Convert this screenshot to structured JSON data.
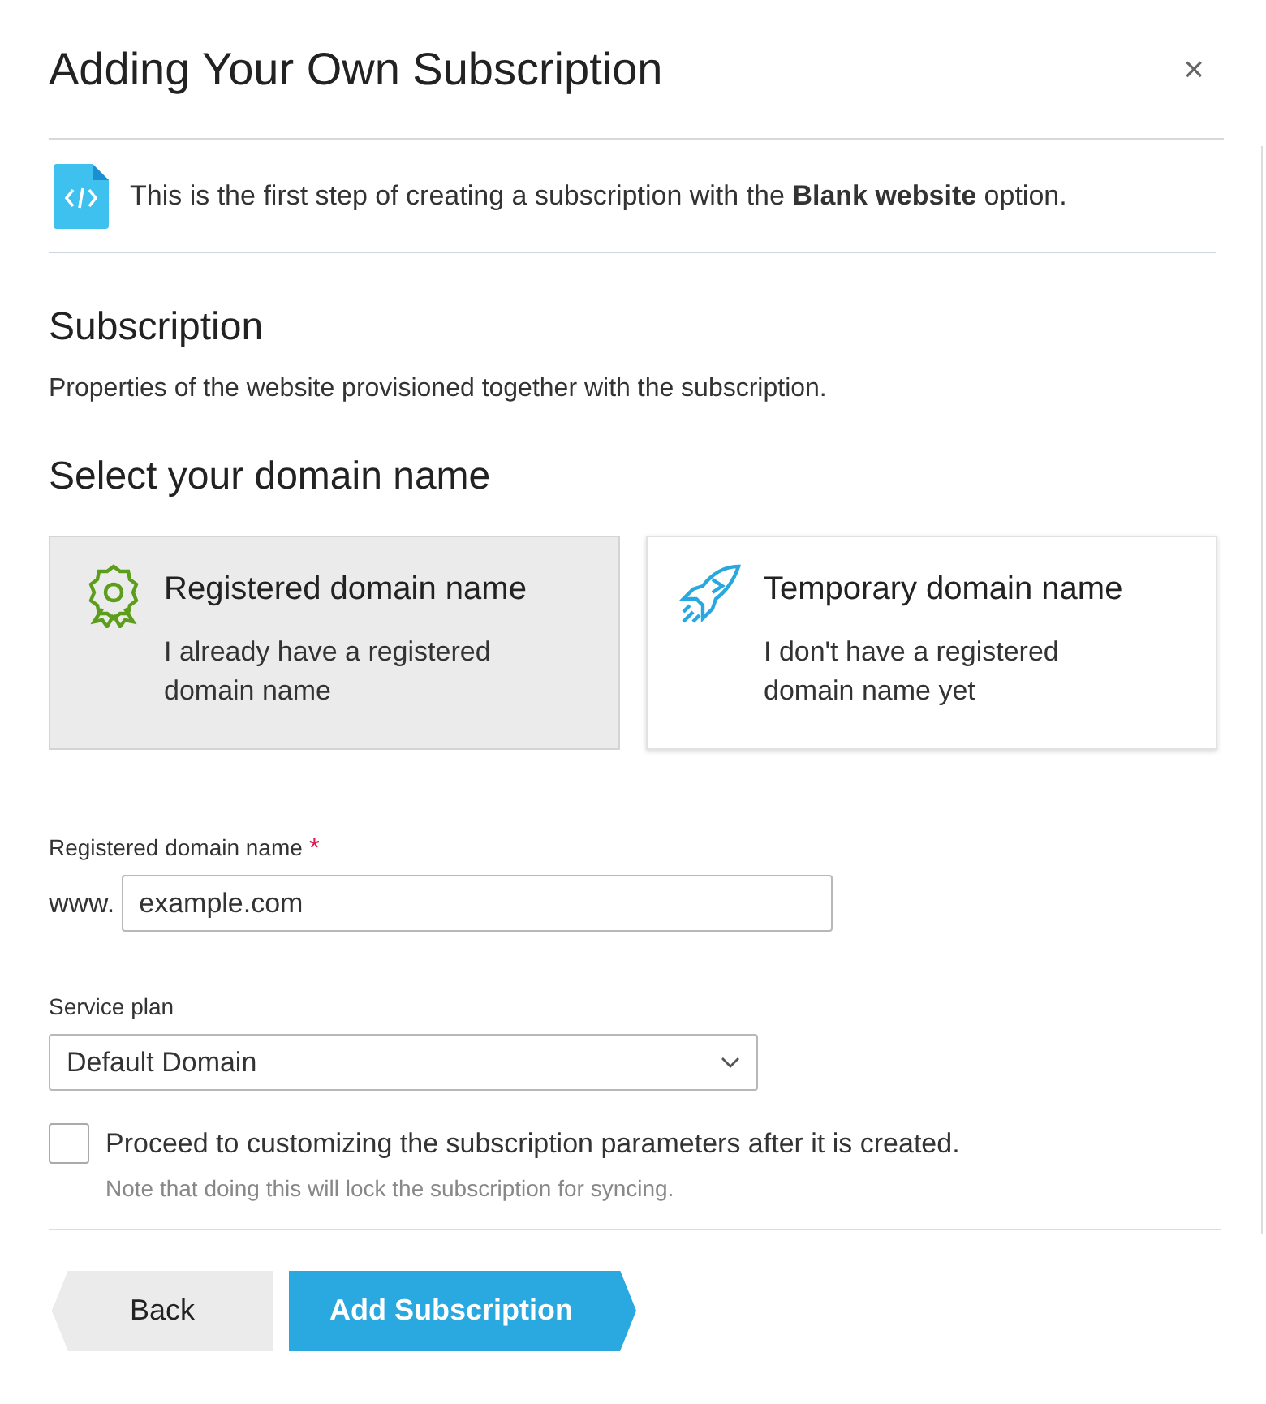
{
  "dialog": {
    "title": "Adding Your Own Subscription",
    "close": "×"
  },
  "info": {
    "text": "This is the first step of creating a subscription with the **Blank website** option."
  },
  "section": {
    "title": "Subscription",
    "description": "Properties of the website provisioned together with the subscription."
  },
  "domain_choice": {
    "title": "Select your domain name",
    "options": [
      {
        "kind": "registered",
        "title": "Registered domain name",
        "description": "I already have a registered domain name",
        "selected": true
      },
      {
        "kind": "temporary",
        "title": "Temporary domain name",
        "description": "I don't have a registered domain name yet",
        "selected": false
      }
    ]
  },
  "domain_field": {
    "label": "Registered domain name",
    "required": "*",
    "prefix": "www.",
    "value": "example.com"
  },
  "service_plan": {
    "label": "Service plan",
    "value": "Default Domain"
  },
  "customize": {
    "label": "Proceed to customizing the subscription parameters after it is created.",
    "note": "Note that doing this will lock the subscription for syncing.",
    "checked": false
  },
  "buttons": [
    {
      "kind": "back",
      "label": "Back"
    },
    {
      "kind": "primary",
      "label": "Add Subscription"
    }
  ]
}
